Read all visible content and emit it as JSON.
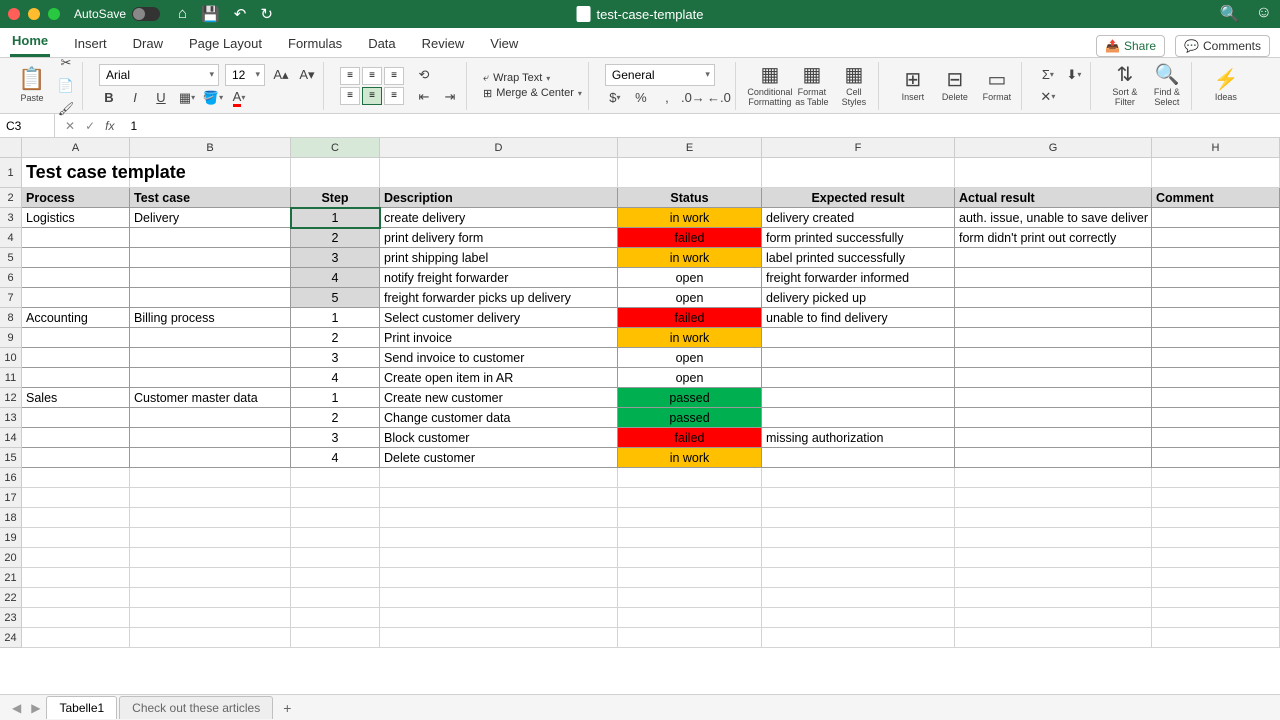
{
  "titlebar": {
    "autosave": "AutoSave",
    "doc": "test-case-template"
  },
  "tabs": {
    "items": [
      "Home",
      "Insert",
      "Draw",
      "Page Layout",
      "Formulas",
      "Data",
      "Review",
      "View"
    ],
    "share": "Share",
    "comments": "Comments"
  },
  "ribbon": {
    "paste": "Paste",
    "font": "Arial",
    "size": "12",
    "wrap": "Wrap Text",
    "merge": "Merge & Center",
    "numfmt": "General",
    "cond": "Conditional Formatting",
    "fmttbl": "Format as Table",
    "cellst": "Cell Styles",
    "insert": "Insert",
    "delete": "Delete",
    "format": "Format",
    "sort": "Sort & Filter",
    "find": "Find & Select",
    "ideas": "Ideas"
  },
  "namebox": "C3",
  "formula": "1",
  "cols": [
    "A",
    "B",
    "C",
    "D",
    "E",
    "F",
    "G",
    "H"
  ],
  "title": "Test case template",
  "headers": [
    "Process",
    "Test case",
    "Step",
    "Description",
    "Status",
    "Expected result",
    "Actual result",
    "Comment"
  ],
  "rows": [
    {
      "n": 3,
      "a": "Logistics",
      "b": "Delivery",
      "c": "1",
      "d": "create delivery",
      "e": "in work",
      "ecls": "st-inwork",
      "f": "delivery created",
      "g": "auth. issue, unable to save deliver",
      "h": ""
    },
    {
      "n": 4,
      "a": "",
      "b": "",
      "c": "2",
      "d": "print delivery form",
      "e": "failed",
      "ecls": "st-failed",
      "f": "form printed successfully",
      "g": "form didn't print out correctly",
      "h": ""
    },
    {
      "n": 5,
      "a": "",
      "b": "",
      "c": "3",
      "d": "print shipping label",
      "e": "in work",
      "ecls": "st-inwork",
      "f": "label printed successfully",
      "g": "",
      "h": ""
    },
    {
      "n": 6,
      "a": "",
      "b": "",
      "c": "4",
      "d": "notify freight forwarder",
      "e": "open",
      "ecls": "st-open",
      "f": "freight forwarder informed",
      "g": "",
      "h": ""
    },
    {
      "n": 7,
      "a": "",
      "b": "",
      "c": "5",
      "d": "freight forwarder picks up delivery",
      "e": "open",
      "ecls": "st-open",
      "f": "delivery picked up",
      "g": "",
      "h": ""
    },
    {
      "n": 8,
      "a": "Accounting",
      "b": "Billing process",
      "c": "1",
      "d": "Select customer delivery",
      "e": "failed",
      "ecls": "st-failed",
      "f": "unable to find delivery",
      "g": "",
      "h": ""
    },
    {
      "n": 9,
      "a": "",
      "b": "",
      "c": "2",
      "d": "Print invoice",
      "e": "in work",
      "ecls": "st-inwork",
      "f": "",
      "g": "",
      "h": ""
    },
    {
      "n": 10,
      "a": "",
      "b": "",
      "c": "3",
      "d": "Send invoice to customer",
      "e": "open",
      "ecls": "st-open",
      "f": "",
      "g": "",
      "h": ""
    },
    {
      "n": 11,
      "a": "",
      "b": "",
      "c": "4",
      "d": "Create open item in AR",
      "e": "open",
      "ecls": "st-open",
      "f": "",
      "g": "",
      "h": ""
    },
    {
      "n": 12,
      "a": "Sales",
      "b": "Customer master data",
      "c": "1",
      "d": "Create new customer",
      "e": "passed",
      "ecls": "st-passed",
      "f": "",
      "g": "",
      "h": ""
    },
    {
      "n": 13,
      "a": "",
      "b": "",
      "c": "2",
      "d": "Change customer data",
      "e": "passed",
      "ecls": "st-passed",
      "f": "",
      "g": "",
      "h": ""
    },
    {
      "n": 14,
      "a": "",
      "b": "",
      "c": "3",
      "d": "Block customer",
      "e": "failed",
      "ecls": "st-failed",
      "f": "missing authorization",
      "g": "",
      "h": ""
    },
    {
      "n": 15,
      "a": "",
      "b": "",
      "c": "4",
      "d": "Delete customer",
      "e": "in work",
      "ecls": "st-inwork",
      "f": "",
      "g": "",
      "h": ""
    }
  ],
  "sheets": {
    "active": "Tabelle1",
    "other": "Check out these articles"
  }
}
